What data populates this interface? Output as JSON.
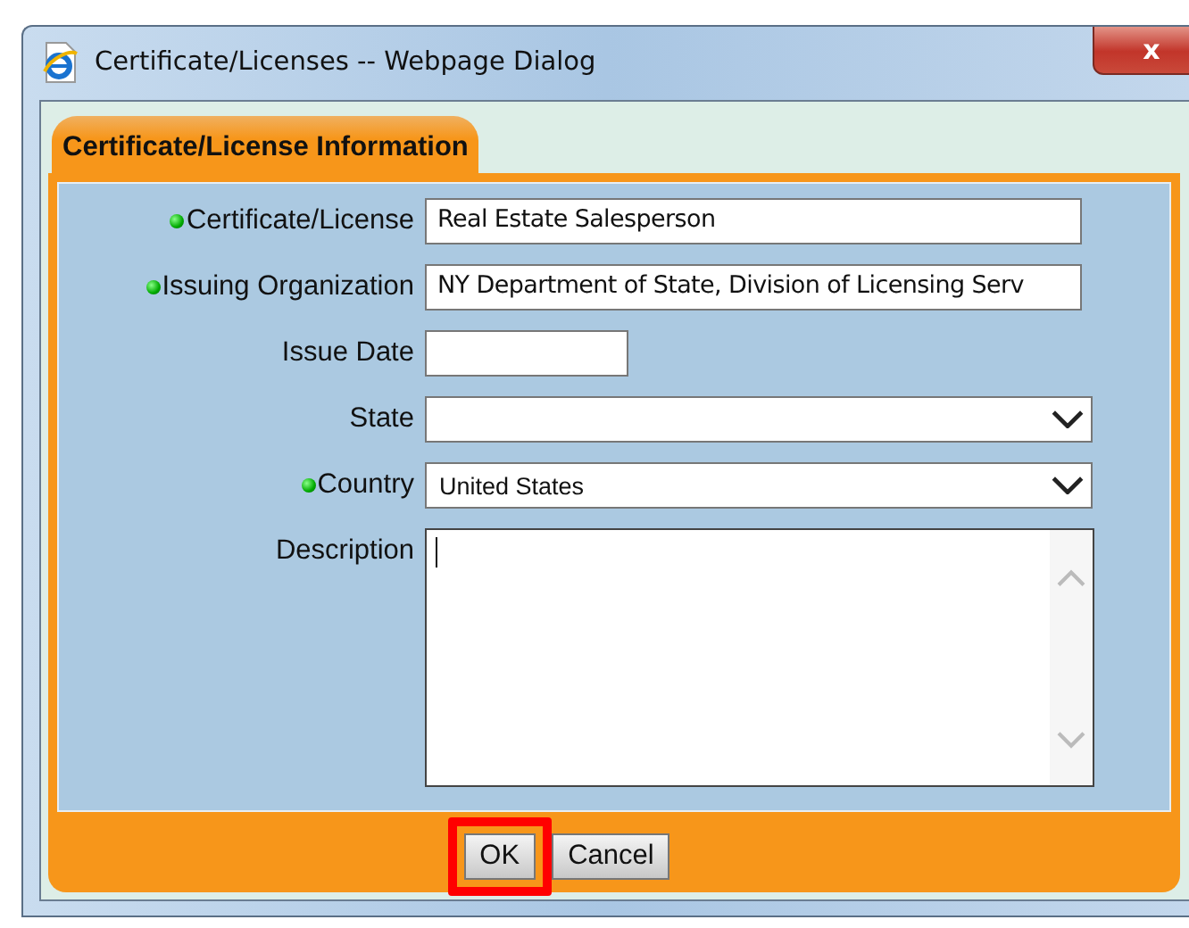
{
  "window": {
    "title": "Certificate/Licenses -- Webpage Dialog",
    "close_label": "x"
  },
  "tabs": [
    {
      "label": "Certificate/License Information",
      "selected": true
    }
  ],
  "fields": [
    {
      "kind": "text",
      "label": "Certificate/License",
      "required": true,
      "value": "Real Estate Salesperson"
    },
    {
      "kind": "text",
      "label": "Issuing Organization",
      "required": true,
      "value": "NY Department of State, Division of Licensing Serv"
    },
    {
      "kind": "date",
      "label": "Issue Date",
      "required": false
    },
    {
      "kind": "select",
      "label": "State",
      "required": false
    },
    {
      "kind": "select",
      "label": "Country",
      "required": true,
      "value": "United States"
    },
    {
      "kind": "textarea",
      "label": "Description",
      "required": false
    }
  ],
  "buttons": [
    {
      "label": "OK",
      "highlighted": true
    },
    {
      "label": "Cancel",
      "highlighted": false
    }
  ]
}
